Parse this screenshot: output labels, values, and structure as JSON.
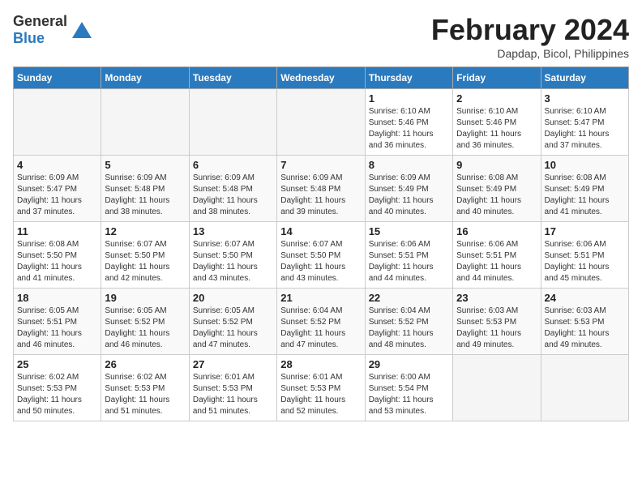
{
  "header": {
    "logo_general": "General",
    "logo_blue": "Blue",
    "month_title": "February 2024",
    "location": "Dapdap, Bicol, Philippines"
  },
  "weekdays": [
    "Sunday",
    "Monday",
    "Tuesday",
    "Wednesday",
    "Thursday",
    "Friday",
    "Saturday"
  ],
  "weeks": [
    [
      {
        "day": "",
        "info": ""
      },
      {
        "day": "",
        "info": ""
      },
      {
        "day": "",
        "info": ""
      },
      {
        "day": "",
        "info": ""
      },
      {
        "day": "1",
        "info": "Sunrise: 6:10 AM\nSunset: 5:46 PM\nDaylight: 11 hours\nand 36 minutes."
      },
      {
        "day": "2",
        "info": "Sunrise: 6:10 AM\nSunset: 5:46 PM\nDaylight: 11 hours\nand 36 minutes."
      },
      {
        "day": "3",
        "info": "Sunrise: 6:10 AM\nSunset: 5:47 PM\nDaylight: 11 hours\nand 37 minutes."
      }
    ],
    [
      {
        "day": "4",
        "info": "Sunrise: 6:09 AM\nSunset: 5:47 PM\nDaylight: 11 hours\nand 37 minutes."
      },
      {
        "day": "5",
        "info": "Sunrise: 6:09 AM\nSunset: 5:48 PM\nDaylight: 11 hours\nand 38 minutes."
      },
      {
        "day": "6",
        "info": "Sunrise: 6:09 AM\nSunset: 5:48 PM\nDaylight: 11 hours\nand 38 minutes."
      },
      {
        "day": "7",
        "info": "Sunrise: 6:09 AM\nSunset: 5:48 PM\nDaylight: 11 hours\nand 39 minutes."
      },
      {
        "day": "8",
        "info": "Sunrise: 6:09 AM\nSunset: 5:49 PM\nDaylight: 11 hours\nand 40 minutes."
      },
      {
        "day": "9",
        "info": "Sunrise: 6:08 AM\nSunset: 5:49 PM\nDaylight: 11 hours\nand 40 minutes."
      },
      {
        "day": "10",
        "info": "Sunrise: 6:08 AM\nSunset: 5:49 PM\nDaylight: 11 hours\nand 41 minutes."
      }
    ],
    [
      {
        "day": "11",
        "info": "Sunrise: 6:08 AM\nSunset: 5:50 PM\nDaylight: 11 hours\nand 41 minutes."
      },
      {
        "day": "12",
        "info": "Sunrise: 6:07 AM\nSunset: 5:50 PM\nDaylight: 11 hours\nand 42 minutes."
      },
      {
        "day": "13",
        "info": "Sunrise: 6:07 AM\nSunset: 5:50 PM\nDaylight: 11 hours\nand 43 minutes."
      },
      {
        "day": "14",
        "info": "Sunrise: 6:07 AM\nSunset: 5:50 PM\nDaylight: 11 hours\nand 43 minutes."
      },
      {
        "day": "15",
        "info": "Sunrise: 6:06 AM\nSunset: 5:51 PM\nDaylight: 11 hours\nand 44 minutes."
      },
      {
        "day": "16",
        "info": "Sunrise: 6:06 AM\nSunset: 5:51 PM\nDaylight: 11 hours\nand 44 minutes."
      },
      {
        "day": "17",
        "info": "Sunrise: 6:06 AM\nSunset: 5:51 PM\nDaylight: 11 hours\nand 45 minutes."
      }
    ],
    [
      {
        "day": "18",
        "info": "Sunrise: 6:05 AM\nSunset: 5:51 PM\nDaylight: 11 hours\nand 46 minutes."
      },
      {
        "day": "19",
        "info": "Sunrise: 6:05 AM\nSunset: 5:52 PM\nDaylight: 11 hours\nand 46 minutes."
      },
      {
        "day": "20",
        "info": "Sunrise: 6:05 AM\nSunset: 5:52 PM\nDaylight: 11 hours\nand 47 minutes."
      },
      {
        "day": "21",
        "info": "Sunrise: 6:04 AM\nSunset: 5:52 PM\nDaylight: 11 hours\nand 47 minutes."
      },
      {
        "day": "22",
        "info": "Sunrise: 6:04 AM\nSunset: 5:52 PM\nDaylight: 11 hours\nand 48 minutes."
      },
      {
        "day": "23",
        "info": "Sunrise: 6:03 AM\nSunset: 5:53 PM\nDaylight: 11 hours\nand 49 minutes."
      },
      {
        "day": "24",
        "info": "Sunrise: 6:03 AM\nSunset: 5:53 PM\nDaylight: 11 hours\nand 49 minutes."
      }
    ],
    [
      {
        "day": "25",
        "info": "Sunrise: 6:02 AM\nSunset: 5:53 PM\nDaylight: 11 hours\nand 50 minutes."
      },
      {
        "day": "26",
        "info": "Sunrise: 6:02 AM\nSunset: 5:53 PM\nDaylight: 11 hours\nand 51 minutes."
      },
      {
        "day": "27",
        "info": "Sunrise: 6:01 AM\nSunset: 5:53 PM\nDaylight: 11 hours\nand 51 minutes."
      },
      {
        "day": "28",
        "info": "Sunrise: 6:01 AM\nSunset: 5:53 PM\nDaylight: 11 hours\nand 52 minutes."
      },
      {
        "day": "29",
        "info": "Sunrise: 6:00 AM\nSunset: 5:54 PM\nDaylight: 11 hours\nand 53 minutes."
      },
      {
        "day": "",
        "info": ""
      },
      {
        "day": "",
        "info": ""
      }
    ]
  ]
}
